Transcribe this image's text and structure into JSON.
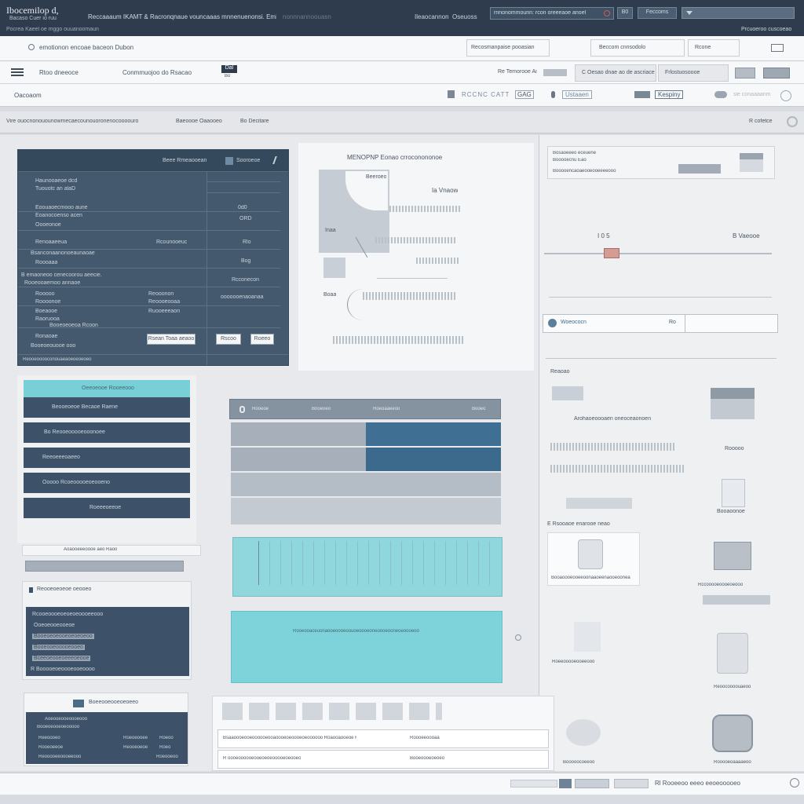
{
  "topbar": {
    "brand": "Ibocemilop d,",
    "brand_sub": "Bacaso Cuer io  ruu",
    "nav": "Reccaaaum IKAMT & Racronqnaue  vouncaaas mnnenuenonsi. Emi.",
    "nav_faint": "nonnnannoouasn",
    "mid_label": "Ileaocannon",
    "mid_right": "Oseuoss",
    "search_value": "rnnonommounn: rcon  oreeeaoe anoel",
    "search_badge": "B0",
    "btn1": "Feccoms",
    "sub_left": "Pocrea Kaeel oe  mggo  ouuanoomaun",
    "sub_right": "Prcuoeroo  cuscoeao"
  },
  "toolbar1": {
    "left": "emotionon  encoae baceon Dubon",
    "box1": "Recosmanpaise  pooasian",
    "box2": "Beccom cnnsodolo",
    "box3": "Rcone"
  },
  "toolbar2": {
    "item1": "Rtoo dneeoce",
    "item2": "Conmmuojoo do Rsacao",
    "badge": "Dal",
    "badge_sub": "Bo",
    "tab1": "Re Temorooe Ai",
    "tab2": "C Oesao dnae ao de ascriace",
    "tab3": "Frlostuosoooe"
  },
  "toolbar3": {
    "left": "Oacoaom",
    "b1": "RCCNC CATT",
    "b2": "GAG",
    "b3": "Ustaaen",
    "b4": "Kespiny",
    "b5": "sie  conaaaanm"
  },
  "breadcrumb": {
    "left": "Vire ouocnonouounowmecaecounouoronenocoooouro",
    "mid1": "Baeoooe Oaaooeo",
    "mid2": "Bo  Decitare",
    "right": "R  cofetce"
  },
  "form_card": {
    "header_right": "Beee  Rmeaooean",
    "header_badge": "Sooroeoe",
    "rows": [
      [
        "Haunooaeoe dcd",
        "",
        ""
      ],
      [
        "Tuouotc an alaD",
        "",
        ""
      ],
      [
        "Eoouaoecmooo aune",
        "",
        "0d0"
      ],
      [
        "Eoanocoenso acen",
        "",
        "ORD"
      ],
      [
        "Oooeonoe",
        "",
        ""
      ],
      [
        "Renoaaeeua",
        "Rcounooeuc",
        "Rlo"
      ],
      [
        "Bsanconaanonoeaunaoae",
        "",
        ""
      ],
      [
        "Roooaaa",
        "",
        "Bog"
      ],
      [
        "B emaoneoo cenecoorou aeecie.",
        "",
        ""
      ],
      [
        "Rooeooaemoo  annaoe",
        "",
        "Rcconecon"
      ],
      [
        "Rooooo",
        "Reooonon",
        "ooooooenaoanaa"
      ],
      [
        "Roooonoe",
        "Reoooeooaa",
        ""
      ],
      [
        "Boeaooe",
        "Ruooeeeaon",
        ""
      ],
      [
        "Raoruooa",
        "",
        ""
      ],
      [
        "Booeoeoeoa  Rcoon",
        "",
        ""
      ],
      [
        "Ronaoae",
        "",
        ""
      ],
      [
        "Booeoeouooe ooo",
        "",
        ""
      ]
    ],
    "btn_a": "Rsean Toaa aeaoo",
    "btn_b": "Rscoo",
    "btn_c": "Roeeo",
    "footer": "Reooeooooconouaeaoeoeoeoeo"
  },
  "diagram": {
    "title": "MENOPNP Eonao  crroconononoe",
    "label1": "Beeroeo",
    "label2": "Ia  Vnaow",
    "label3": "Inaa",
    "label4": "Boaa",
    "row1": "Raoaaconnoen  uneon",
    "row2": "Baaoonae",
    "row3": "Rnaaaao  eooeenn",
    "row4": "Bnoaeo  eo  aoe",
    "row5": "Baoaeoeee",
    "row6": "Booeooonoaenon",
    "row7": "Rsooeeao"
  },
  "right_panel": {
    "card_l1": "Bosaoeeeo  eceuene",
    "card_l2": "Booooecnu  Eao",
    "card_l3": "Booooencaoaeooeooeeeeooo",
    "slider_left": "I  0 5",
    "slider_right": "B  Vaeooe",
    "slider_value": 0.28,
    "search_label": "Woeococn",
    "search_count": "Ro",
    "section_label": "Reaoao",
    "item1": "Arohaoeoooaen  oneoceaonoen",
    "item2": "Rooooo",
    "item3": "Booaoonoe",
    "item4": "Rsoaonae  Enoe",
    "section2": "E  Rsooaoe enarooe neao",
    "item5": "Booaoooeooeeoonaaoeenaooeoonea",
    "item6": "Rccooooeoooeoeooo",
    "item7": "Roeeooooeooeeooo",
    "item8": "Reoocoooouaeoo",
    "item9": "Booooocoeeoo",
    "item10": "Rooooeoaaaaeoo"
  },
  "left_list": {
    "header": "Oeeoeooe  Rooeeooo",
    "items": [
      "Beooeoeoe  Becaoe  Raene",
      "Bo  Reooeooooeooonoee",
      "Reeoeeeoaeeo",
      "Ooooo  Rcoeooooeoeooeno",
      "Roeeeoeeoe"
    ],
    "search": "Aoaooeeeoooe  aeo  Raoo",
    "group_title": "Reooeoeoeoe  oeooeo",
    "group_items": [
      "Rcooeoooeoeoeoeoooeeooo",
      "Ooeoeooeooeoe",
      "Booeoeoeooeoeoeoeoo",
      "Booeooeooooeooeo",
      "Bceeoeooeoeeeoeooe",
      "R  Booooeoeoooeooeoooo"
    ]
  },
  "bottom_left": {
    "title": "Boeeooeooeoeoeeo",
    "r1": "Aoeooeooeoooeooo",
    "r2": "Booeoeooeoeooooo",
    "r3": "Reeoooeo",
    "r3b": "Roeoeooee",
    "r3c": "Roeoo",
    "r4": "Rooeoeeoe",
    "r4b": "Reooeoeoe",
    "r4c": "Roeo",
    "r5": "Reooooeeoooeeooo",
    "r5b": "Roeooeoo"
  },
  "center": {
    "table_head": [
      "Rooeoe",
      "Bnoeoeo",
      "Roeoaaeeoo",
      "Booeo"
    ],
    "banner": "Rooeooaceuonaooeoooeoouoeoooeoneoooeooneoeoooeoo",
    "table2_r1": "Bsaaoooeooeoooooeooaoooeoeoooeoeoooooo  Roaooaooeoe  R",
    "table2_r1b": "Roooeeoooaa",
    "table2_r2": "R  oooeoooooeooeoeoeooooeoeooeo",
    "table2_r2b": "Booeoooeoeoeo"
  },
  "statusbar": {
    "text": "Rl  Rooeeoo  eeeo  eeoeooooeo"
  }
}
